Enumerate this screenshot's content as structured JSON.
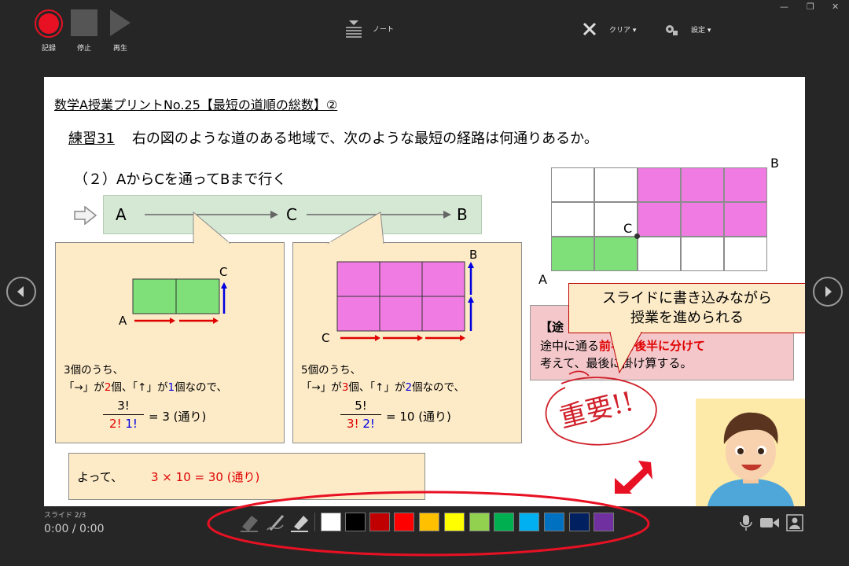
{
  "toolbar": {
    "record_label": "記録",
    "stop_label": "停止",
    "play_label": "再生",
    "notes_label": "ノート",
    "clear_label": "クリア ▾",
    "settings_label": "設定 ▾"
  },
  "slide": {
    "title": "数学A授業プリントNo.25【最短の道順の総数】②",
    "question_number": "練習31",
    "question_text": "右の図のような道のある地域で、次のような最短の経路は何通りあるか。",
    "sub_question": "（２）AからCを通ってBまで行く",
    "flow": {
      "a": "A",
      "c": "C",
      "b": "B"
    },
    "left_callout": {
      "label_a": "A",
      "label_c": "C",
      "line1": "3個のうち、",
      "line2_pre": "「→」が",
      "line2_n1": "2",
      "line2_mid": "個、「↑」が",
      "line2_n2": "1",
      "line2_post": "個なので、",
      "num": "3!",
      "den_a": "2!",
      "den_b": "1!",
      "result": "= 3 (通り)"
    },
    "right_callout": {
      "label_b": "B",
      "label_c": "C",
      "line1": "5個のうち、",
      "line2_pre": "「→」が",
      "line2_n1": "3",
      "line2_mid": "個、「↑」が",
      "line2_n2": "2",
      "line2_post": "個なので、",
      "num": "5!",
      "den_a": "3!",
      "den_b": "2!",
      "result": "= 10 (通り)"
    },
    "conclusion_pre": "よって、",
    "conclusion_expr": "3 × 10 = 30 (通り)",
    "grid_labels": {
      "a": "A",
      "b": "B",
      "c": "C"
    },
    "note_head": "【途",
    "note_line1_pre": "途中に通る",
    "note_line1_red": "前半と後半に分けて",
    "note_line2": "考えて、最後に掛け算する。",
    "speech": "スライドに書き込みながら\n授業を進められる",
    "handwriting": "重要!!"
  },
  "footer": {
    "slide_number": "スライド 2/3",
    "timer": "0:00 / 0:00"
  },
  "colors": {
    "record": "#e81123",
    "green_cell": "#7fe07a",
    "pink_cell": "#f07ce3",
    "swatches": [
      "#ffffff",
      "#000000",
      "#c00000",
      "#ff0000",
      "#ffc000",
      "#ffff00",
      "#92d050",
      "#00b050",
      "#00b0f0",
      "#0070c0",
      "#002060",
      "#7030a0"
    ]
  }
}
